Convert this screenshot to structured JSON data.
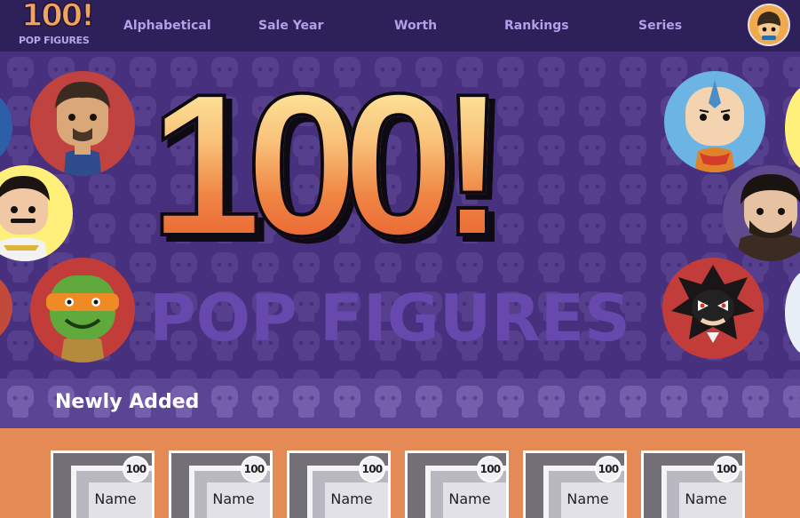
{
  "nav": {
    "logo": {
      "big": "100!",
      "sub": "POP FIGURES"
    },
    "links": [
      "Alphabetical",
      "Sale Year",
      "Worth",
      "Rankings",
      "Series"
    ],
    "avatar_icon": "user-avatar-icon"
  },
  "hero": {
    "title": "100!",
    "subtitle": "POP FIGURES",
    "figures": [
      "doctor-strange-figure-icon",
      "freddie-mercury-figure-icon",
      "michelangelo-turtle-figure-icon",
      "aang-figure-icon",
      "jon-snow-figure-icon",
      "shadow-hedgehog-figure-icon"
    ]
  },
  "section": {
    "title": "Newly Added"
  },
  "cards": [
    {
      "badge": "100",
      "name": "Name"
    },
    {
      "badge": "100",
      "name": "Name"
    },
    {
      "badge": "100",
      "name": "Name"
    },
    {
      "badge": "100",
      "name": "Name"
    },
    {
      "badge": "100",
      "name": "Name"
    },
    {
      "badge": "100",
      "name": "Name"
    }
  ],
  "colors": {
    "nav_bg": "#2e2058",
    "hero_bg": "#47307d",
    "section_bg": "#5a4595",
    "cards_bg": "#e48a55",
    "nav_link": "#b39fea",
    "accent_orange": "#f2a35c"
  }
}
